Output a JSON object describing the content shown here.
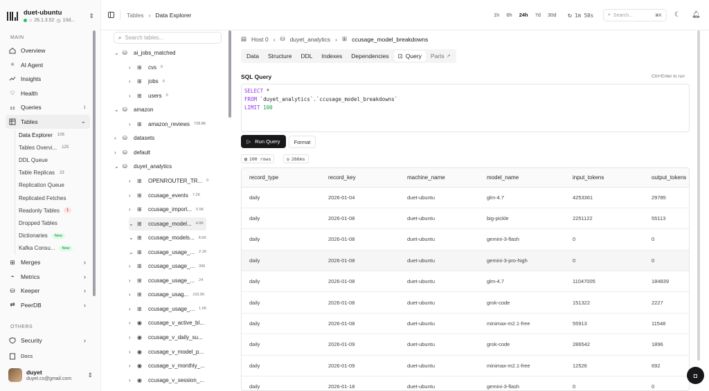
{
  "brand": {
    "name": "duet-ubuntu",
    "version": "26.1.3.52",
    "uptime": "10d..."
  },
  "sidebar": {
    "main_label": "MAIN",
    "items": [
      {
        "label": "Overview",
        "icon": "home-icon",
        "count": ""
      },
      {
        "label": "AI Agent",
        "icon": "sparkle-icon",
        "count": ""
      },
      {
        "label": "Insights",
        "icon": "trend-icon",
        "count": ""
      },
      {
        "label": "Health",
        "icon": "heart-icon",
        "count": ""
      },
      {
        "label": "Queries",
        "icon": "queries-icon",
        "count": "1"
      },
      {
        "label": "Tables",
        "icon": "table-icon",
        "count": ""
      }
    ],
    "tables_sub": [
      {
        "label": "Data Explorer",
        "count": "106"
      },
      {
        "label": "Tables Overvi...",
        "count": "125"
      },
      {
        "label": "DDL Queue",
        "count": ""
      },
      {
        "label": "Table Replicas",
        "count": "23"
      },
      {
        "label": "Replication Queue",
        "count": ""
      },
      {
        "label": "Replicated Fetches",
        "count": ""
      },
      {
        "label": "Readonly Tables",
        "count": "1"
      },
      {
        "label": "Dropped Tables",
        "count": ""
      },
      {
        "label": "Dictionaries",
        "badge": "New"
      },
      {
        "label": "Kafka Consu...",
        "badge": "New"
      }
    ],
    "more": [
      {
        "label": "Merges",
        "icon": "merge-icon"
      },
      {
        "label": "Metrics",
        "icon": "metrics-icon"
      },
      {
        "label": "Keeper",
        "icon": "keeper-icon"
      },
      {
        "label": "PeerDB",
        "icon": "peerdb-icon"
      }
    ],
    "others_label": "OTHERS",
    "others": [
      {
        "label": "Security",
        "icon": "shield-icon"
      },
      {
        "label": "Docs",
        "icon": "book-icon"
      }
    ],
    "user": {
      "name": "duyet",
      "email": "duyet.cs@gmail.com"
    }
  },
  "header": {
    "crumb_1": "Tables",
    "crumb_2": "Data Explorer",
    "ranges": [
      "1h",
      "6h",
      "24h",
      "7d",
      "30d"
    ],
    "selected_range": "24h",
    "refresh": "1m 50s",
    "search_placeholder": "Search...",
    "shortcut": "⌘K"
  },
  "tree": {
    "search_placeholder": "Search tables...",
    "rows": [
      {
        "level": 0,
        "chev": "⌄",
        "icon": "db",
        "label": "ai_jobs_matched",
        "count": ""
      },
      {
        "level": 1,
        "chev": "›",
        "icon": "tbl",
        "label": "cvs",
        "count": "0"
      },
      {
        "level": 1,
        "chev": "›",
        "icon": "tbl",
        "label": "jobs",
        "count": "0"
      },
      {
        "level": 1,
        "chev": "›",
        "icon": "tbl",
        "label": "users",
        "count": "0"
      },
      {
        "level": 0,
        "chev": "⌄",
        "icon": "db",
        "label": "amazon",
        "count": ""
      },
      {
        "level": 1,
        "chev": "›",
        "icon": "tbl",
        "label": "amazon_reviews",
        "count": "728.8K"
      },
      {
        "level": 0,
        "chev": "›",
        "icon": "db",
        "label": "datasets",
        "count": ""
      },
      {
        "level": 0,
        "chev": "›",
        "icon": "db",
        "label": "default",
        "count": ""
      },
      {
        "level": 0,
        "chev": "⌄",
        "icon": "db",
        "label": "duyet_analytics",
        "count": ""
      },
      {
        "level": 1,
        "chev": "›",
        "icon": "tbl",
        "label": "OPENROUTER_TR...",
        "count": "0"
      },
      {
        "level": 1,
        "chev": "›",
        "icon": "tbl",
        "label": "ccusage_events",
        "count": "7.2K"
      },
      {
        "level": 1,
        "chev": "›",
        "icon": "tbl",
        "label": "ccusage_import...",
        "count": "5.5K"
      },
      {
        "level": 1,
        "chev": "⌄",
        "icon": "tbl",
        "label": "ccusage_model...",
        "count": "4.9K",
        "sel": true
      },
      {
        "level": 1,
        "chev": "⌄",
        "icon": "tbl",
        "label": "ccusage_models...",
        "count": "8.5K"
      },
      {
        "level": 1,
        "chev": "⌄",
        "icon": "tbl",
        "label": "ccusage_usage_...",
        "count": "2.1K"
      },
      {
        "level": 1,
        "chev": "›",
        "icon": "tbl",
        "label": "ccusage_usage_...",
        "count": "396"
      },
      {
        "level": 1,
        "chev": "›",
        "icon": "tbl",
        "label": "ccusage_usage_...",
        "count": "24"
      },
      {
        "level": 1,
        "chev": "›",
        "icon": "tbl",
        "label": "ccusage_usag...",
        "count": "103.5K"
      },
      {
        "level": 1,
        "chev": "›",
        "icon": "tbl",
        "label": "ccusage_usage_...",
        "count": "1.5K"
      },
      {
        "level": 1,
        "chev": "›",
        "icon": "view",
        "label": "ccusage_v_active_bl...",
        "count": ""
      },
      {
        "level": 1,
        "chev": "›",
        "icon": "view",
        "label": "ccusage_v_daily_su...",
        "count": ""
      },
      {
        "level": 1,
        "chev": "›",
        "icon": "view",
        "label": "ccusage_v_model_p...",
        "count": ""
      },
      {
        "level": 1,
        "chev": "›",
        "icon": "view",
        "label": "ccusage_v_monthly_...",
        "count": ""
      },
      {
        "level": 1,
        "chev": "›",
        "icon": "view",
        "label": "ccusage_v_session_...",
        "count": ""
      }
    ]
  },
  "main": {
    "crumb": [
      "Host 0",
      "duyet_analytics",
      "ccusage_model_breakdowns"
    ],
    "tabs": [
      "Data",
      "Structure",
      "DDL",
      "Indexes",
      "Dependencies",
      "Query",
      "Parts"
    ],
    "active_tab": "Query",
    "sql_label": "SQL Query",
    "sql_hint": "Ctrl+Enter to run",
    "sql": {
      "l1_kw": "SELECT",
      "l1_rest": " *",
      "l2_kw": "FROM",
      "l2_rest": " `duyet_analytics`.`ccusage_model_breakdowns`",
      "l3_kw": "LIMIT",
      "l3_num": " 100"
    },
    "run_label": "Run Query",
    "format_label": "Format",
    "rows_stat": "100 rows",
    "time_stat": "266ms",
    "columns": [
      "record_type",
      "record_key",
      "machine_name",
      "model_name",
      "input_tokens",
      "output_tokens"
    ],
    "rows": [
      [
        "daily",
        "2026-01-04",
        "duet-ubuntu",
        "glm-4.7",
        "4253361",
        "29785"
      ],
      [
        "daily",
        "2026-01-08",
        "duet-ubuntu",
        "big-pickle",
        "2251122",
        "55113"
      ],
      [
        "daily",
        "2026-01-08",
        "duet-ubuntu",
        "gemini-3-flash",
        "0",
        "0"
      ],
      [
        "daily",
        "2026-01-08",
        "duet-ubuntu",
        "gemini-3-pro-high",
        "0",
        "0"
      ],
      [
        "daily",
        "2026-01-08",
        "duet-ubuntu",
        "glm-4.7",
        "11047005",
        "184839"
      ],
      [
        "daily",
        "2026-01-08",
        "duet-ubuntu",
        "grok-code",
        "151322",
        "2227"
      ],
      [
        "daily",
        "2026-01-08",
        "duet-ubuntu",
        "minimax-m2.1-free",
        "55913",
        "11548"
      ],
      [
        "daily",
        "2026-01-09",
        "duet-ubuntu",
        "grok-code",
        "286542",
        "1896"
      ],
      [
        "daily",
        "2026-01-09",
        "duet-ubuntu",
        "minimax-m2.1-free",
        "12526",
        "692"
      ],
      [
        "daily",
        "2026-01-18",
        "duet-ubuntu",
        "gemini-3-flash",
        "0",
        "0"
      ]
    ]
  }
}
